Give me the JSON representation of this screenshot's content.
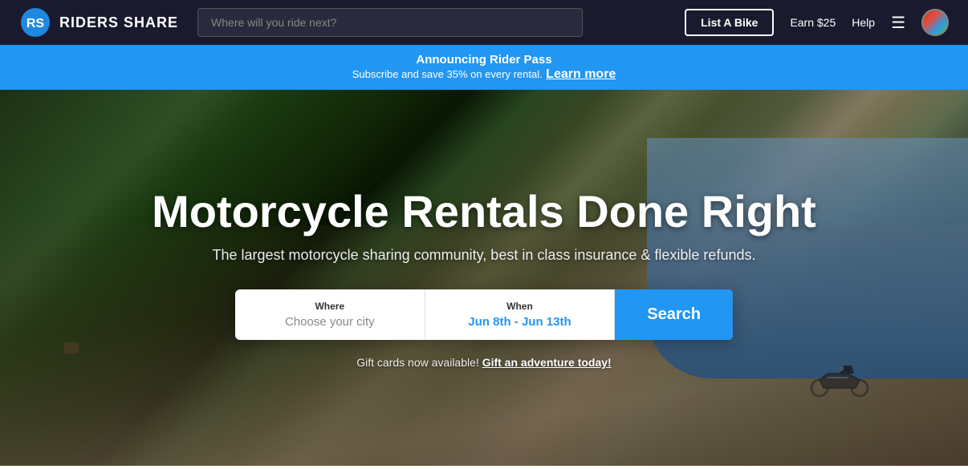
{
  "navbar": {
    "brand_name": "RIDERS SHARE",
    "search_placeholder": "Where will you ride next?",
    "list_bike_label": "List A Bike",
    "earn_label": "Earn $25",
    "help_label": "Help"
  },
  "announcement": {
    "title": "Announcing Rider Pass",
    "subtitle": "Subscribe and save 35% on every rental.",
    "link_text": "Learn more"
  },
  "hero": {
    "title": "Motorcycle Rentals Done Right",
    "subtitle": "The largest motorcycle sharing community, best in class insurance & flexible refunds.",
    "search": {
      "where_label": "Where",
      "where_placeholder": "Choose your city",
      "when_label": "When",
      "when_value_start": "Jun 8th",
      "when_separator": " - ",
      "when_value_end": "Jun 13th",
      "search_button": "Search"
    },
    "gift_text": "Gift cards now available!",
    "gift_link": "Gift an adventure today!"
  }
}
